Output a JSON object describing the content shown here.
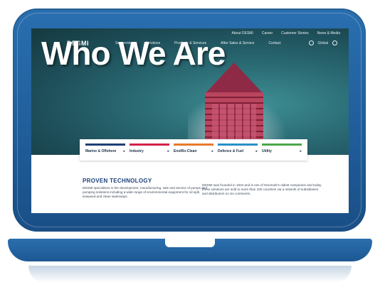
{
  "hero": {
    "title": "Who We Are"
  },
  "top_links": [
    "About DESMI",
    "Career",
    "Customer Stories",
    "News & Media"
  ],
  "nav": {
    "logo": "DESMI",
    "items": [
      "Segments",
      "Solutions",
      "Products & Services",
      "After Sales & Service",
      "Contact"
    ],
    "language_label": "Global"
  },
  "categories": [
    {
      "label": "Marine & Offshore",
      "color": "#1f3f78"
    },
    {
      "label": "Industry",
      "color": "#d4214a"
    },
    {
      "label": "EnviRo-Clean",
      "color": "#e8792a"
    },
    {
      "label": "Defence & Fuel",
      "color": "#2a8fc8"
    },
    {
      "label": "Utility",
      "color": "#4ba64a"
    }
  ],
  "content": {
    "section_title": "PROVEN TECHNOLOGY",
    "left_text": "DESMI specialises in the development, manufacturing, sale and service of pumps and pumping solutions including a wide range of environmental equipment for oil spill, seaweed and clean waterways.",
    "right_text": "DESMI was founded in 1834 and is one of Denmark's oldest companies and today these solutions are sold to more than 100 countries via a network of subsidiaries and distributors on six continents."
  },
  "colors": {
    "frame": "#1f5c98",
    "accent": "#1a3f7a"
  }
}
